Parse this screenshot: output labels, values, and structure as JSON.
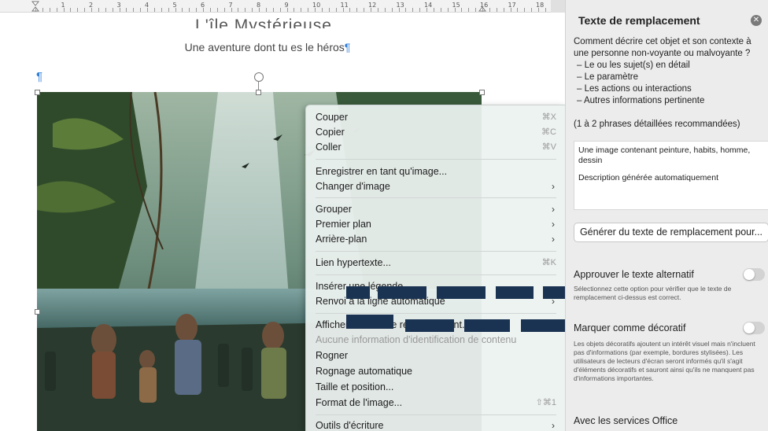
{
  "document": {
    "title": "L'île Mystérieuse",
    "subtitle": "Une aventure dont tu es le héros",
    "pilcrow": "¶",
    "ruler_numbers": [
      "1",
      "2",
      "3",
      "4",
      "5",
      "6",
      "7",
      "8",
      "9",
      "10",
      "11",
      "12",
      "13",
      "14",
      "15",
      "16",
      "17",
      "18"
    ]
  },
  "context_menu": {
    "items": [
      {
        "label": "Couper",
        "shortcut": "⌘X"
      },
      {
        "label": "Copier",
        "shortcut": "⌘C"
      },
      {
        "label": "Coller",
        "shortcut": "⌘V"
      },
      {
        "label": "Enregistrer en tant qu'image..."
      },
      {
        "label": "Changer d'image",
        "arrow": "›"
      },
      {
        "label": "Grouper",
        "arrow": "›"
      },
      {
        "label": "Premier plan",
        "arrow": "›"
      },
      {
        "label": "Arrière-plan",
        "arrow": "›"
      },
      {
        "label": "Lien hypertexte...",
        "shortcut": "⌘K"
      },
      {
        "label": "Insérer une légende..."
      },
      {
        "label": "Renvoi à la ligne automatique",
        "arrow": "›"
      },
      {
        "label": "Afficher le texte de remplacement..."
      },
      {
        "label": "Aucune information d'identification de contenu"
      },
      {
        "label": "Rogner"
      },
      {
        "label": "Rognage automatique"
      },
      {
        "label": "Taille et position..."
      },
      {
        "label": "Format de l'image...",
        "shortcut": "⇧⌘1"
      },
      {
        "label": "Outils d'écriture",
        "arrow": "›"
      }
    ]
  },
  "pane": {
    "title": "Texte de remplacement",
    "intro": "Comment décrire cet objet et son contexte à une personne non-voyante ou malvoyante ?",
    "list": [
      "– Le ou les sujet(s) en détail",
      "– Le paramètre",
      "– Les actions ou interactions",
      "– Autres informations pertinente"
    ],
    "hint": "(1 à 2 phrases détaillées recommandées)",
    "alt_text_line1": "Une image contenant peinture, habits, homme, dessin",
    "alt_text_line2": "Description générée automatiquement",
    "generate_button": "Générer du texte de remplacement pour...",
    "approve_label": "Approuver le texte alternatif",
    "approve_note": "Sélectionnez cette option pour vérifier que le texte de remplacement ci-dessus est correct.",
    "decorative_label": "Marquer comme décoratif",
    "decorative_note": "Les objets décoratifs ajoutent un intérêt visuel mais n'incluent pas d'informations (par exemple, bordures stylisées). Les utilisateurs de lecteurs d'écran seront informés qu'il s'agit d'éléments décoratifs et sauront ainsi qu'ils ne manquent pas d'informations importantes.",
    "office_services": "Avec les services Office",
    "close_glyph": "✕"
  },
  "colors": {
    "pilcrow": "#2f7fd9",
    "dash_overlay": "#1b3352"
  }
}
